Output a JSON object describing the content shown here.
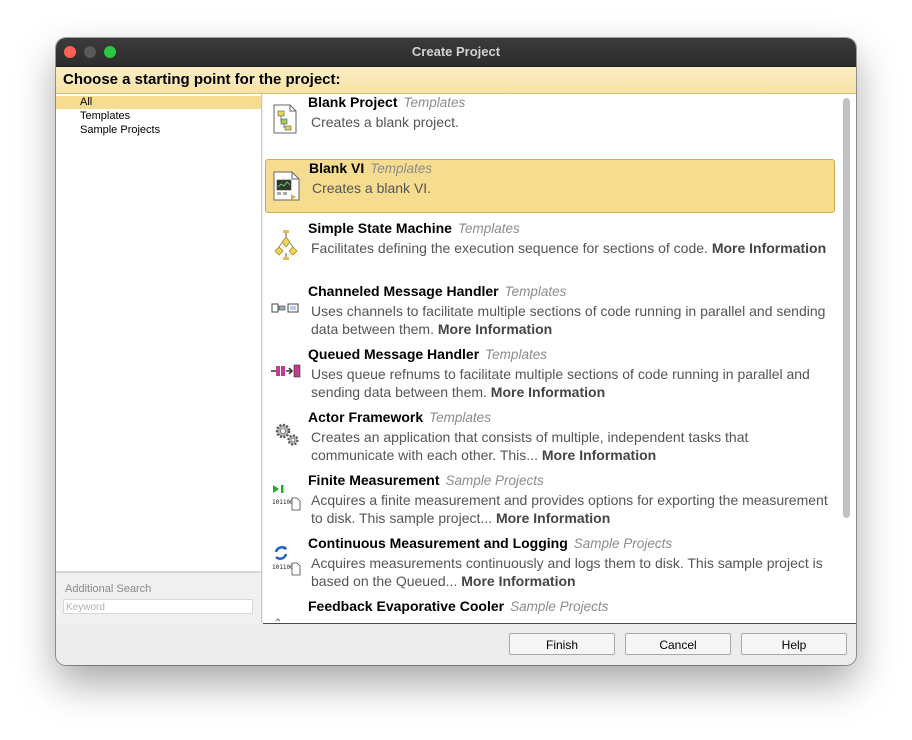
{
  "window": {
    "title": "Create Project"
  },
  "banner": {
    "text": "Choose a starting point for the project:"
  },
  "sidebar": {
    "categories": [
      {
        "label": "All",
        "selected": true
      },
      {
        "label": "Templates",
        "selected": false
      },
      {
        "label": "Sample Projects",
        "selected": false
      }
    ],
    "additional_search_label": "Additional Search",
    "keyword_placeholder": "Keyword"
  },
  "items": [
    {
      "name": "Blank Project",
      "category": "Templates",
      "description": "Creates a blank project.",
      "more": "",
      "icon": "blank-project-icon",
      "selected": false
    },
    {
      "name": "Blank VI",
      "category": "Templates",
      "description": "Creates a blank VI.",
      "more": "",
      "icon": "blank-vi-icon",
      "selected": true
    },
    {
      "name": "Simple State Machine",
      "category": "Templates",
      "description": "Facilitates defining the execution sequence for sections of code.",
      "more": "More Information",
      "icon": "state-machine-icon",
      "selected": false
    },
    {
      "name": "Channeled Message Handler",
      "category": "Templates",
      "description": "Uses channels to facilitate multiple sections of code running in parallel and sending data between them.",
      "more": "More Information",
      "icon": "channel-icon",
      "selected": false
    },
    {
      "name": "Queued Message Handler",
      "category": "Templates",
      "description": "Uses queue refnums to facilitate multiple sections of code running in parallel and sending data between them.",
      "more": "More Information",
      "icon": "queue-icon",
      "selected": false
    },
    {
      "name": "Actor Framework",
      "category": "Templates",
      "description": "Creates an application that consists of multiple, independent tasks that communicate with each other. This...",
      "more": "More Information",
      "icon": "gears-icon",
      "selected": false
    },
    {
      "name": "Finite Measurement",
      "category": "Sample Projects",
      "description": "Acquires a finite measurement and provides options for exporting the measurement to disk. This sample project...",
      "more": "More Information",
      "icon": "finite-measurement-icon",
      "selected": false
    },
    {
      "name": "Continuous Measurement and Logging",
      "category": "Sample Projects",
      "description": "Acquires measurements continuously and logs them to disk. This sample project is based on the Queued...",
      "more": "More Information",
      "icon": "continuous-measurement-icon",
      "selected": false
    },
    {
      "name": "Feedback Evaporative Cooler",
      "category": "Sample Projects",
      "description": "",
      "more": "",
      "icon": "cooler-icon",
      "selected": false
    }
  ],
  "buttons": {
    "finish": "Finish",
    "cancel": "Cancel",
    "help": "Help"
  },
  "colors": {
    "selection": "#f5dc8f",
    "banner": "#f7e2a5",
    "titlebar": "#2d2d2d"
  }
}
